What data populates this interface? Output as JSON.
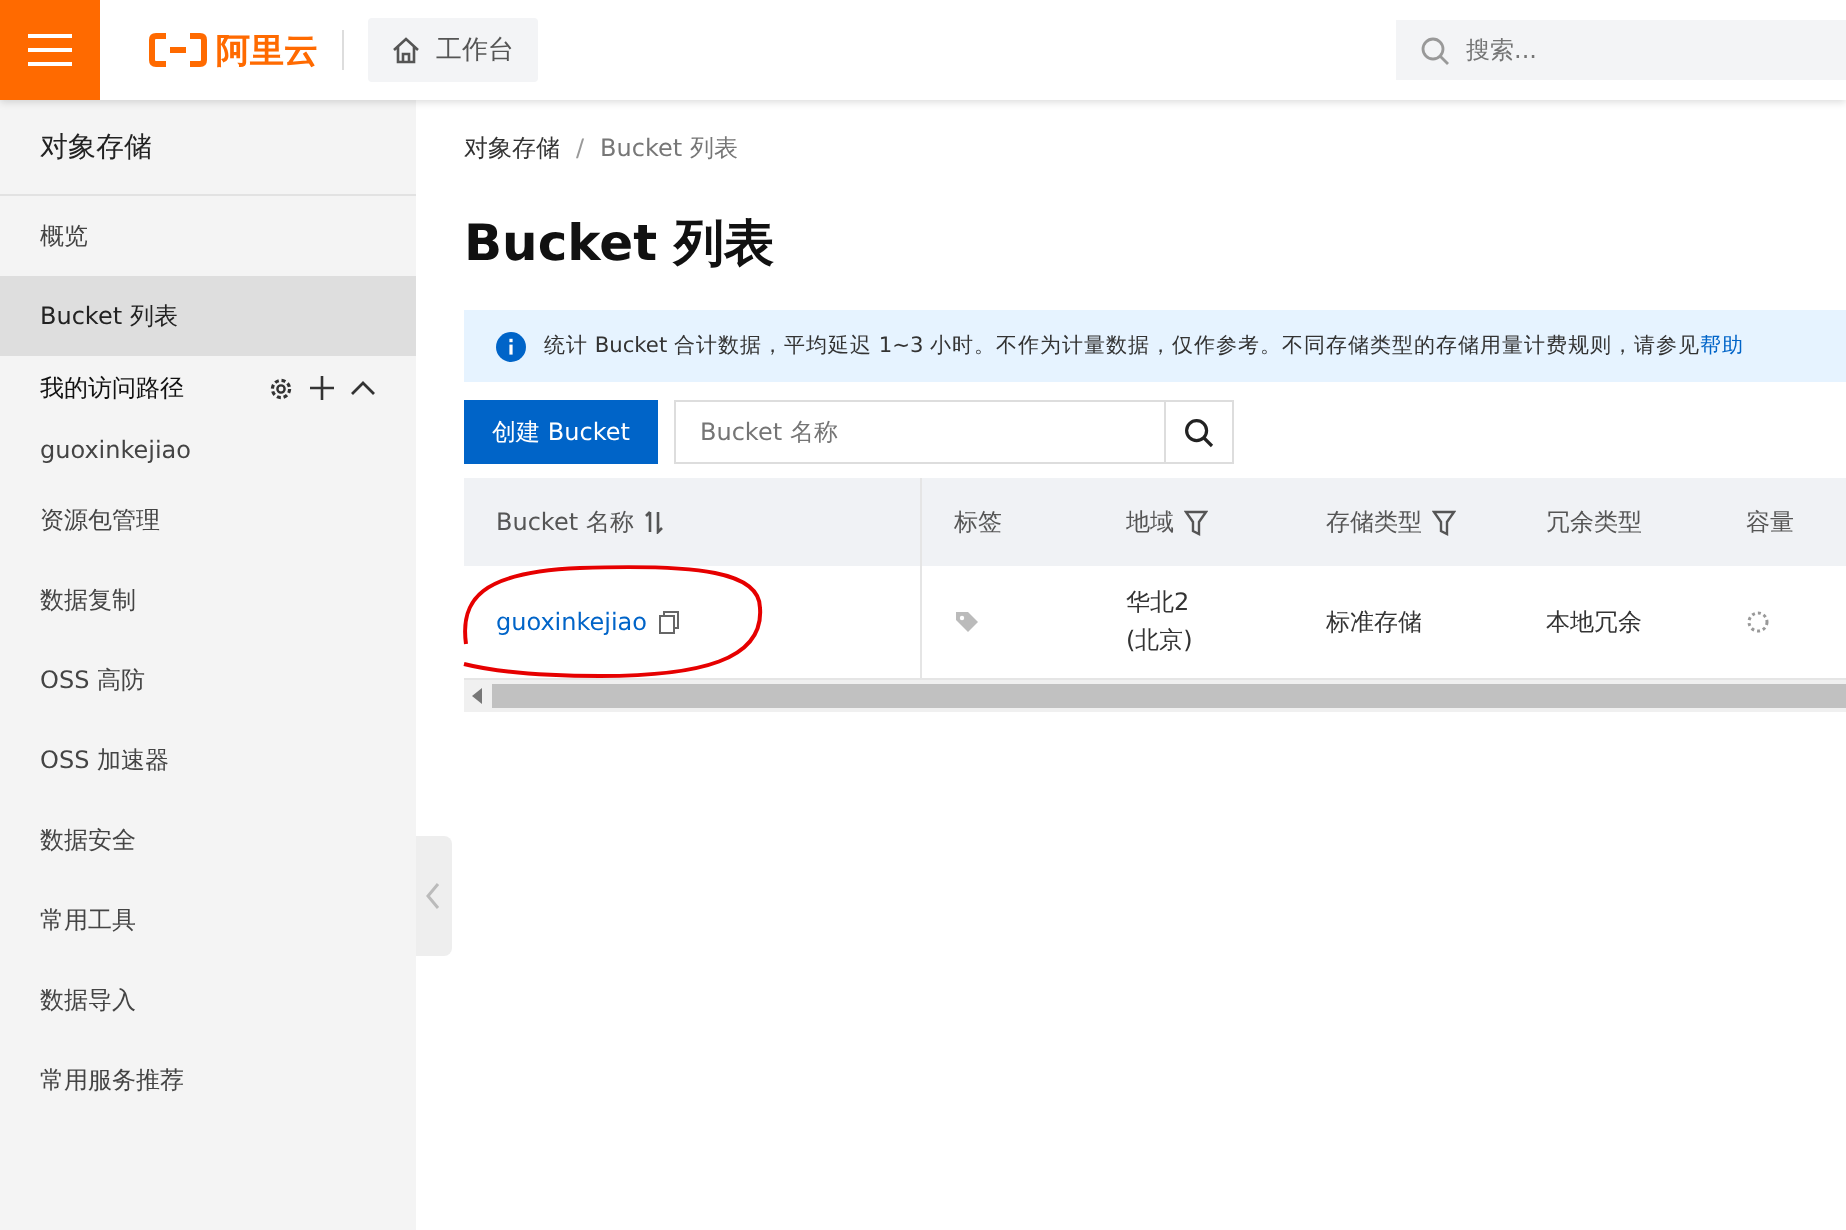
{
  "header": {
    "logo": "阿里云",
    "home": "工作台",
    "search": {
      "placeholder": "搜索..."
    }
  },
  "sidebar": {
    "title": "对象存储",
    "items": [
      {
        "label": "概览",
        "kind": "link",
        "selected": false
      },
      {
        "label": "Bucket 列表",
        "kind": "link",
        "selected": true
      },
      {
        "label": "我的访问路径",
        "kind": "section"
      },
      {
        "label": "guoxinkejiao",
        "kind": "link",
        "selected": false
      },
      {
        "label": "资源包管理",
        "kind": "link",
        "selected": false
      },
      {
        "label": "数据复制",
        "kind": "link",
        "selected": false
      },
      {
        "label": "OSS 高防",
        "kind": "link",
        "selected": false
      },
      {
        "label": "OSS 加速器",
        "kind": "link",
        "selected": false
      },
      {
        "label": "数据安全",
        "kind": "link",
        "selected": false
      },
      {
        "label": "常用工具",
        "kind": "link",
        "selected": false
      },
      {
        "label": "数据导入",
        "kind": "link",
        "selected": false
      },
      {
        "label": "常用服务推荐",
        "kind": "link",
        "selected": false
      }
    ]
  },
  "breadcrumb": {
    "items": [
      "对象存储",
      "Bucket 列表"
    ],
    "separator": "/"
  },
  "page_title": "Bucket 列表",
  "notice": {
    "text": "统计 Bucket 合计数据，平均延迟 1~3 小时。不作为计量数据，仅作参考。不同存储类型的存储用量计费规则，请参见",
    "link": "帮助"
  },
  "create_button": "创建 Bucket",
  "bucket_search": {
    "placeholder": "Bucket 名称"
  },
  "table": {
    "columns": [
      {
        "label": "Bucket 名称",
        "kind": "sort"
      },
      {
        "label": "标签",
        "kind": "plain"
      },
      {
        "label": "地域",
        "kind": "filter"
      },
      {
        "label": "存储类型",
        "kind": "filter"
      },
      {
        "label": "冗余类型",
        "kind": "plain"
      },
      {
        "label": "容量",
        "kind": "plain"
      }
    ],
    "rows": [
      {
        "name": "guoxinkejiao",
        "region": [
          "华北2",
          "(北京)"
        ],
        "storage": "标准存储",
        "redundancy": "本地冗余",
        "circled": true
      }
    ]
  }
}
